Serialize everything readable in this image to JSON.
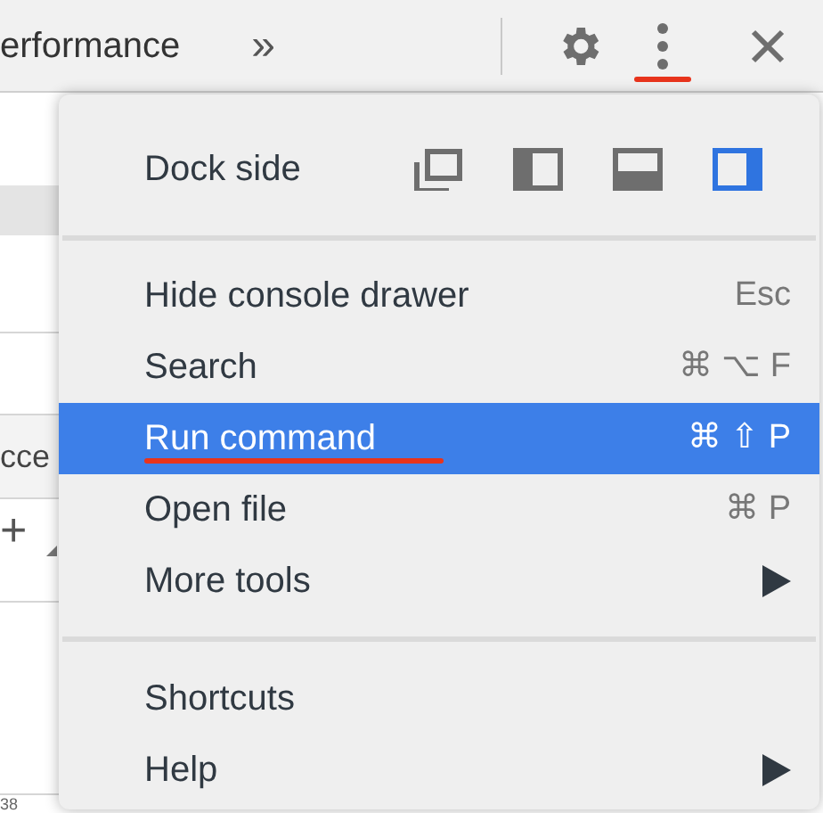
{
  "toolbar": {
    "tab_label": "erformance",
    "overflow": "»",
    "buttons": [
      {
        "kind": "settings",
        "underlined": false
      },
      {
        "kind": "more",
        "underlined": true
      },
      {
        "kind": "close",
        "underlined": false
      }
    ]
  },
  "background": {
    "row_text": "cce",
    "add_symbol": "+",
    "cut_number": "38"
  },
  "menu": {
    "dock": {
      "label": "Dock side",
      "options": [
        {
          "kind": "undock",
          "selected": false
        },
        {
          "kind": "left",
          "selected": false
        },
        {
          "kind": "bottom",
          "selected": false
        },
        {
          "kind": "right",
          "selected": true
        }
      ]
    },
    "sections": [
      [
        {
          "label": "Hide console drawer",
          "shortcut": "Esc",
          "submenu": false,
          "selected": false,
          "underlined": false
        },
        {
          "label": "Search",
          "shortcut": "⌘ ⌥ F",
          "submenu": false,
          "selected": false,
          "underlined": false
        },
        {
          "label": "Run command",
          "shortcut": "⌘ ⇧ P",
          "submenu": false,
          "selected": true,
          "underlined": true
        },
        {
          "label": "Open file",
          "shortcut": "⌘ P",
          "submenu": false,
          "selected": false,
          "underlined": false
        },
        {
          "label": "More tools",
          "submenu": true,
          "selected": false,
          "underlined": false
        }
      ],
      [
        {
          "label": "Shortcuts",
          "submenu": false,
          "selected": false,
          "underlined": false
        },
        {
          "label": "Help",
          "submenu": true,
          "selected": false,
          "underlined": false
        }
      ]
    ]
  }
}
